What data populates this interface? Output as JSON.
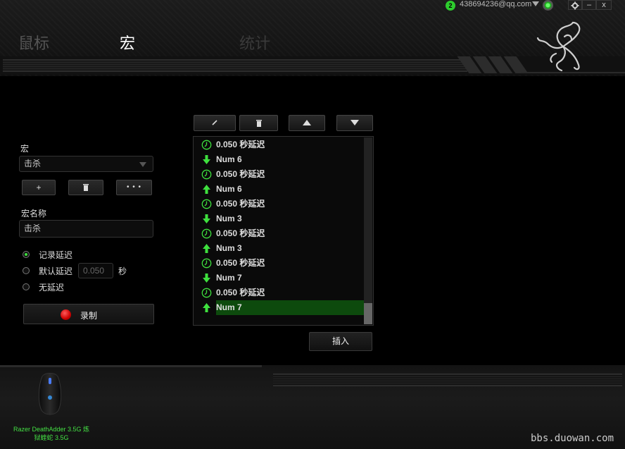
{
  "account": {
    "badge_count": "2",
    "email": "438694236@qq.com"
  },
  "window": {
    "settings_icon": "gear-icon",
    "minimize_label": "–",
    "close_label": "x"
  },
  "tabs": [
    {
      "label": "鼠标"
    },
    {
      "label": "宏"
    },
    {
      "label": "统计"
    }
  ],
  "macro": {
    "section_label": "宏",
    "selected": "击杀",
    "add_label": "+",
    "more_label": "• • •",
    "name_label": "宏名称",
    "name_value": "击杀",
    "delay_options": [
      {
        "label": "记录延迟",
        "checked": true
      },
      {
        "label": "默认延迟",
        "checked": false
      },
      {
        "label": "无延迟",
        "checked": false
      }
    ],
    "default_delay_placeholder": "0.050",
    "delay_unit": "秒",
    "record_label": "录制"
  },
  "events": [
    {
      "type": "delay",
      "text": "0.050 秒延迟"
    },
    {
      "type": "down",
      "text": "Num 6"
    },
    {
      "type": "delay",
      "text": "0.050 秒延迟"
    },
    {
      "type": "up",
      "text": "Num 6"
    },
    {
      "type": "delay",
      "text": "0.050 秒延迟"
    },
    {
      "type": "down",
      "text": "Num 3"
    },
    {
      "type": "delay",
      "text": "0.050 秒延迟"
    },
    {
      "type": "up",
      "text": "Num 3"
    },
    {
      "type": "delay",
      "text": "0.050 秒延迟"
    },
    {
      "type": "down",
      "text": "Num 7"
    },
    {
      "type": "delay",
      "text": "0.050 秒延迟"
    },
    {
      "type": "up",
      "text": "Num 7",
      "selected": true
    }
  ],
  "insert_label": "插入",
  "device": {
    "name_line1": "Razer DeathAdder 3.5G 炼",
    "name_line2": "狱蝰蛇 3.5G"
  },
  "watermark": "bbs.duowan.com",
  "colors": {
    "accent_green": "#44e044",
    "selection_bg": "#0d4a0d",
    "record_red": "#cc0000"
  }
}
